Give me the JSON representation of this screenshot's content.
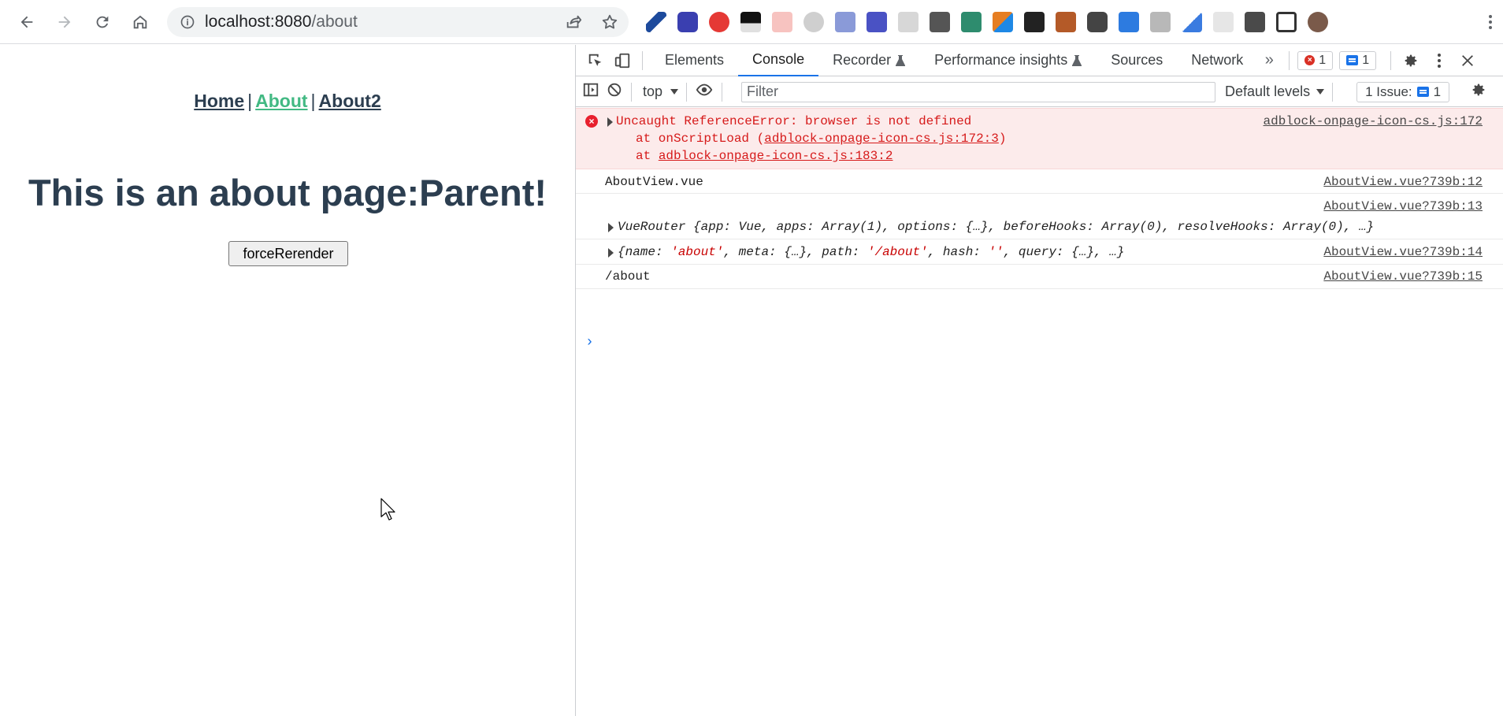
{
  "browser": {
    "url_host": "localhost:8080",
    "url_path": "/about"
  },
  "page": {
    "nav_home": "Home",
    "nav_about": "About",
    "nav_about2": "About2",
    "nav_sep": "|",
    "heading": "This is an about page:Parent!",
    "button_label": "forceRerender"
  },
  "devtools": {
    "tabs": [
      "Elements",
      "Console",
      "Recorder",
      "Performance insights",
      "Sources",
      "Network"
    ],
    "error_count": "1",
    "message_count": "1",
    "context": "top",
    "filter_placeholder": "Filter",
    "levels": "Default levels",
    "issues_label": "1 Issue:",
    "issues_count": "1"
  },
  "console": {
    "error": {
      "line1": "Uncaught ReferenceError: browser is not defined",
      "line2_prefix": "at onScriptLoad (",
      "line2_link": "adblock-onpage-icon-cs.js:172:3",
      "line2_suffix": ")",
      "line3_prefix": "at ",
      "line3_link": "adblock-onpage-icon-cs.js:183:2",
      "source": "adblock-onpage-icon-cs.js:172"
    },
    "log1": {
      "text": "AboutView.vue",
      "source": "AboutView.vue?739b:12"
    },
    "log2": {
      "text": "VueRouter {app: Vue, apps: Array(1), options: {…}, beforeHooks: Array(0), resolveHooks: Array(0), …}",
      "source": "AboutView.vue?739b:13"
    },
    "log3": {
      "text_pre": "{name: ",
      "name_val": "'about'",
      "text_mid1": ", meta: {…}, path: ",
      "path_val": "'/about'",
      "text_mid2": ", hash: ",
      "hash_val": "''",
      "text_end": ", query: {…}, …}",
      "source": "AboutView.vue?739b:14"
    },
    "log4": {
      "text": "/about",
      "source": "AboutView.vue?739b:15"
    },
    "prompt": "›"
  },
  "colors": {
    "vue_green": "#42b983",
    "vue_dark": "#2c3e50",
    "error_red": "#d61a1a",
    "devtools_blue": "#1a73e8"
  }
}
